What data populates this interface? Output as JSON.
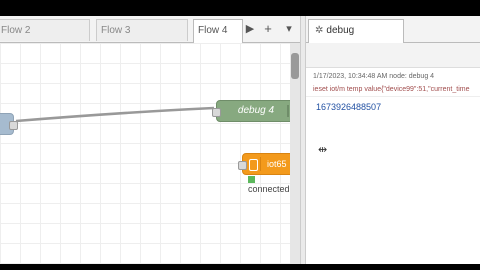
{
  "workspace": {
    "tabs": [
      {
        "label": "Flow 2",
        "active": false
      },
      {
        "label": "Flow 3",
        "active": false
      },
      {
        "label": "Flow 4",
        "active": true
      }
    ],
    "controls": {
      "scroll_right": "▶",
      "add": "+",
      "menu": "▾"
    },
    "nodes": {
      "debug": {
        "label": "debug 4"
      },
      "iot": {
        "label": "iot65",
        "status": "connected"
      }
    }
  },
  "sidebar": {
    "tab": {
      "icon": "bug-icon",
      "label": "debug"
    },
    "message": {
      "meta": "1/17/2023, 10:34:48 AM   node: debug 4",
      "topic": "ieset iot/m temp value{\"device99\":51,\"current_time",
      "value": "1673926488507"
    }
  },
  "colors": {
    "debug_node": "#87a980",
    "iot_node": "#f39a1c",
    "inject_node": "#a6bbcf",
    "status_connected": "#5cb85c",
    "value_text": "#2251a3"
  }
}
